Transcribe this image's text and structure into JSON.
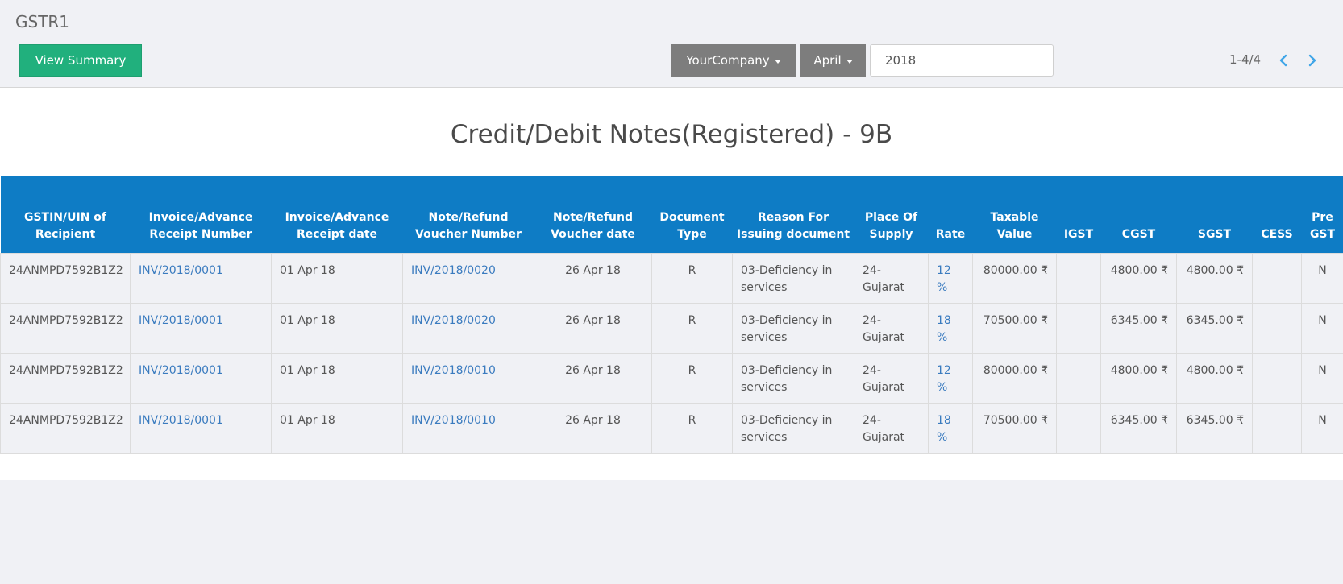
{
  "header": {
    "title": "GSTR1",
    "view_summary_label": "View Summary",
    "company_label": "YourCompany",
    "month_label": "April",
    "year_value": "2018",
    "pager_value": "1-4/4",
    "icons": {
      "prev": "chevron-left-icon",
      "next": "chevron-right-icon",
      "caret": "caret-down-icon"
    },
    "colors": {
      "primary_button": "#21b07d",
      "dropdown": "#7d7d7d",
      "pager_arrow": "#3fa5e8"
    }
  },
  "report": {
    "title": "Credit/Debit Notes(Registered) - 9B",
    "columns": [
      "GSTIN/UIN of Recipient",
      "Invoice/Advance Receipt Number",
      "Invoice/Advance Receipt date",
      "Note/Refund Voucher Number",
      "Note/Refund Voucher date",
      "Document Type",
      "Reason For Issuing document",
      "Place Of Supply",
      "Rate",
      "Taxable Value",
      "IGST",
      "CGST",
      "SGST",
      "CESS",
      "Pre GST"
    ],
    "rows": [
      [
        "24ANMPD7592B1Z2",
        "INV/2018/0001",
        "01 Apr 18",
        "INV/2018/0020",
        "26 Apr 18",
        "R",
        "03-Deficiency in services",
        "24-Gujarat",
        "12 %",
        "80000.00 ₹",
        "",
        "4800.00 ₹",
        "4800.00 ₹",
        "",
        "N"
      ],
      [
        "24ANMPD7592B1Z2",
        "INV/2018/0001",
        "01 Apr 18",
        "INV/2018/0020",
        "26 Apr 18",
        "R",
        "03-Deficiency in services",
        "24-Gujarat",
        "18 %",
        "70500.00 ₹",
        "",
        "6345.00 ₹",
        "6345.00 ₹",
        "",
        "N"
      ],
      [
        "24ANMPD7592B1Z2",
        "INV/2018/0001",
        "01 Apr 18",
        "INV/2018/0010",
        "26 Apr 18",
        "R",
        "03-Deficiency in services",
        "24-Gujarat",
        "12 %",
        "80000.00 ₹",
        "",
        "4800.00 ₹",
        "4800.00 ₹",
        "",
        "N"
      ],
      [
        "24ANMPD7592B1Z2",
        "INV/2018/0001",
        "01 Apr 18",
        "INV/2018/0010",
        "26 Apr 18",
        "R",
        "03-Deficiency in services",
        "24-Gujarat",
        "18 %",
        "70500.00 ₹",
        "",
        "6345.00 ₹",
        "6345.00 ₹",
        "",
        "N"
      ]
    ],
    "header_color": "#0e7cc5",
    "link_color": "#3a7bbf"
  }
}
